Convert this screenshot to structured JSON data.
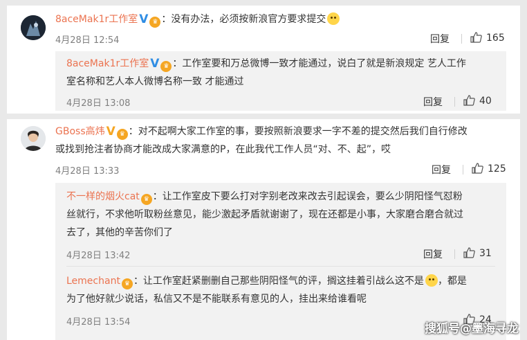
{
  "comments": [
    {
      "user": "8aceMak1r工作室",
      "text": "：没有办法，必须按新浪官方要求提交",
      "time": "4月28日 12:54",
      "reply_label": "回复",
      "likes": "165",
      "badges": [
        "verified-blue",
        "crown"
      ],
      "replies": [
        {
          "user": "8aceMak1r工作室",
          "lines": [
            "：工作室要和万总微博一致才能通过，说白了就是新浪规定 艺人工作",
            "室名称和艺人本人微博名称一致 才能通过"
          ],
          "time": "4月28日 13:08",
          "reply_label": "回复",
          "likes": "40"
        }
      ]
    },
    {
      "user": "GBoss高炜",
      "lines": [
        "：对不起啊大家工作室的事，要按照新浪要求一字不差的提交然后我们自行修改",
        "或找到抢注者协商才能改成大家满意的P，在此我代工作人员“对、不、起”，哎"
      ],
      "time": "4月28日 13:33",
      "reply_label": "回复",
      "likes": "125",
      "replies": [
        {
          "user": "不一样的烟火cat",
          "lines": [
            "：让工作室皮下要么打对字别老改来改去引起误会，要么少阴阳怪气怼粉",
            "丝就行，不求他听取粉丝意见，能少激起矛盾就谢谢了，现在还都是小事，大家磨合磨合就过",
            "去了，其他的辛苦你们了"
          ],
          "time": "4月28日 13:42",
          "reply_label": "回复",
          "likes": "31"
        },
        {
          "user": "Lemechant",
          "lines": [
            "：让工作室赶紧删删自己那些阴阳怪气的评，搁这挂着引战么这不是",
            "，都是",
            "为了他好就少说话，私信又不是不能联系有意见的人，挂出来给谁看呢"
          ],
          "time": "4月28日 13:54",
          "reply_label": "回复",
          "likes": "24"
        }
      ]
    }
  ],
  "watermark": "搜狐号@墨海寻龙",
  "colors": {
    "username": "#eb7350",
    "verified": "#2f8de4",
    "gold": "#f5a623",
    "meta": "#808080"
  }
}
